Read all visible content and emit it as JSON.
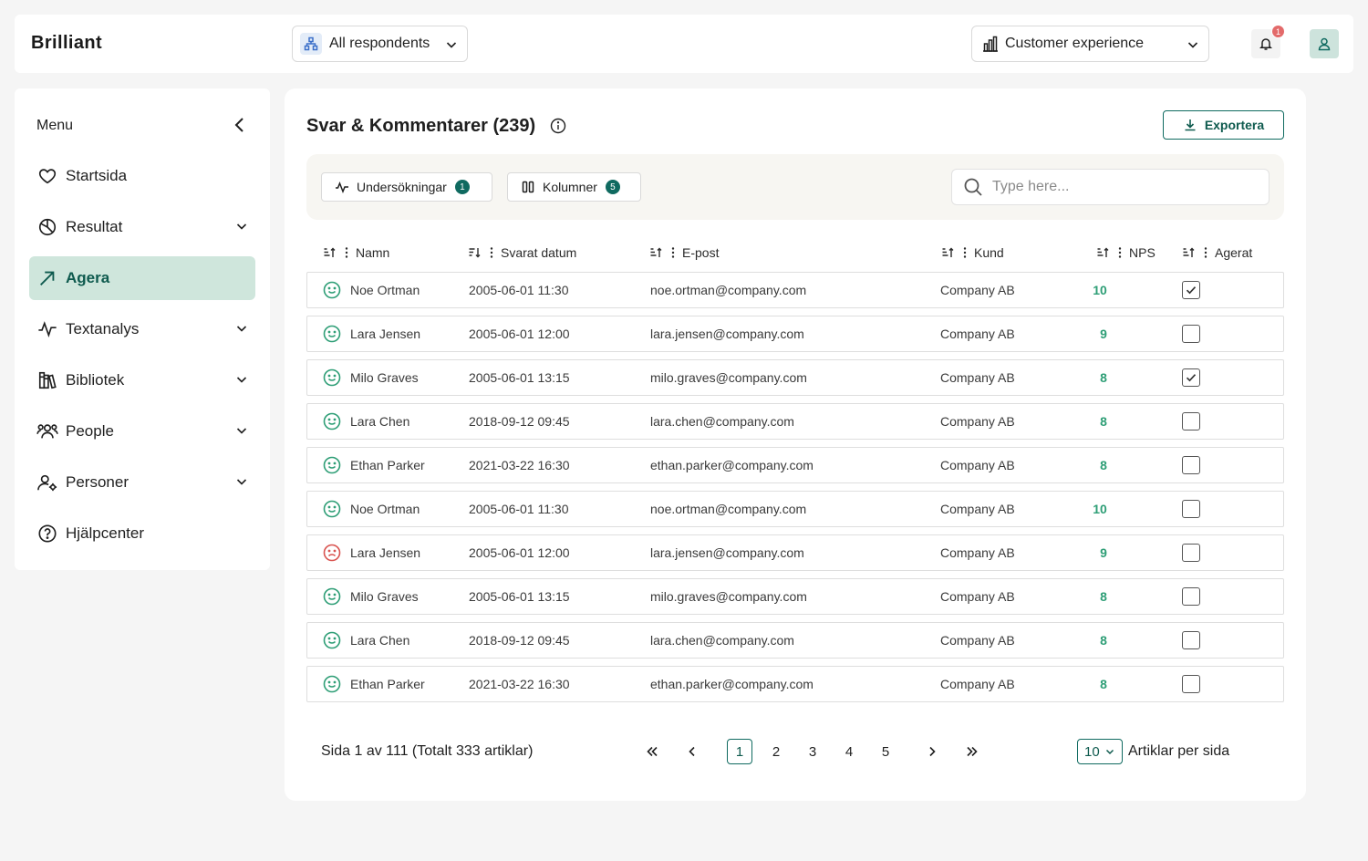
{
  "app": {
    "logo": "Brilliant"
  },
  "topbar": {
    "respondents_label": "All respondents",
    "dashboard_label": "Customer experience",
    "notification_count": "1"
  },
  "sidebar": {
    "menu_label": "Menu",
    "items": [
      {
        "label": "Startsida",
        "icon": "heart-icon",
        "has_chevron": false,
        "active": false
      },
      {
        "label": "Resultat",
        "icon": "pie-chart-icon",
        "has_chevron": true,
        "active": false
      },
      {
        "label": "Agera",
        "icon": "arrow-up-right-icon",
        "has_chevron": false,
        "active": true
      },
      {
        "label": "Textanalys",
        "icon": "activity-icon",
        "has_chevron": true,
        "active": false
      },
      {
        "label": "Bibliotek",
        "icon": "library-icon",
        "has_chevron": true,
        "active": false
      },
      {
        "label": "People",
        "icon": "people-icon",
        "has_chevron": true,
        "active": false
      },
      {
        "label": "Personer",
        "icon": "user-gear-icon",
        "has_chevron": true,
        "active": false
      },
      {
        "label": "Hjälpcenter",
        "icon": "help-icon",
        "has_chevron": false,
        "active": false
      }
    ]
  },
  "main": {
    "title": "Svar & Kommentarer (239)",
    "export_label": "Exportera",
    "filters": {
      "surveys_label": "Undersökningar",
      "surveys_count": "1",
      "columns_label": "Kolumner",
      "columns_count": "5",
      "search_placeholder": "Type here..."
    },
    "columns": [
      "Namn",
      "Svarat datum",
      "E-post",
      "Kund",
      "NPS",
      "Agerat"
    ],
    "rows": [
      {
        "name": "Noe Ortman",
        "date": "2005-06-01 11:30",
        "email": "noe.ortman@company.com",
        "customer": "Company AB",
        "nps": "10",
        "acted": true,
        "mood": "happy"
      },
      {
        "name": "Lara Jensen",
        "date": "2005-06-01 12:00",
        "email": "lara.jensen@company.com",
        "customer": "Company AB",
        "nps": "9",
        "acted": false,
        "mood": "happy"
      },
      {
        "name": "Milo Graves",
        "date": "2005-06-01 13:15",
        "email": "milo.graves@company.com",
        "customer": "Company AB",
        "nps": "8",
        "acted": true,
        "mood": "happy"
      },
      {
        "name": "Lara Chen",
        "date": "2018-09-12 09:45",
        "email": "lara.chen@company.com",
        "customer": "Company AB",
        "nps": "8",
        "acted": false,
        "mood": "happy"
      },
      {
        "name": "Ethan Parker",
        "date": "2021-03-22 16:30",
        "email": "ethan.parker@company.com",
        "customer": "Company AB",
        "nps": "8",
        "acted": false,
        "mood": "happy"
      },
      {
        "name": "Noe Ortman",
        "date": "2005-06-01 11:30",
        "email": "noe.ortman@company.com",
        "customer": "Company AB",
        "nps": "10",
        "acted": false,
        "mood": "happy"
      },
      {
        "name": "Lara Jensen",
        "date": "2005-06-01 12:00",
        "email": "lara.jensen@company.com",
        "customer": "Company AB",
        "nps": "9",
        "acted": false,
        "mood": "sad"
      },
      {
        "name": "Milo Graves",
        "date": "2005-06-01 13:15",
        "email": "milo.graves@company.com",
        "customer": "Company AB",
        "nps": "8",
        "acted": false,
        "mood": "happy"
      },
      {
        "name": "Lara Chen",
        "date": "2018-09-12 09:45",
        "email": "lara.chen@company.com",
        "customer": "Company AB",
        "nps": "8",
        "acted": false,
        "mood": "happy"
      },
      {
        "name": "Ethan Parker",
        "date": "2021-03-22 16:30",
        "email": "ethan.parker@company.com",
        "customer": "Company AB",
        "nps": "8",
        "acted": false,
        "mood": "happy"
      }
    ],
    "pagination": {
      "summary": "Sida 1 av 111 (Totalt 333 artiklar)",
      "pages": [
        "1",
        "2",
        "3",
        "4",
        "5"
      ],
      "current_page": "1",
      "per_page": "10",
      "per_page_label": "Artiklar per sida"
    }
  },
  "colors": {
    "accent": "#0f6a60",
    "active_bg": "#cfe6dc",
    "nps_green": "#2e9e76",
    "happy": "#2e9e76",
    "sad": "#d9534f",
    "badge_red": "#e36a6a"
  }
}
